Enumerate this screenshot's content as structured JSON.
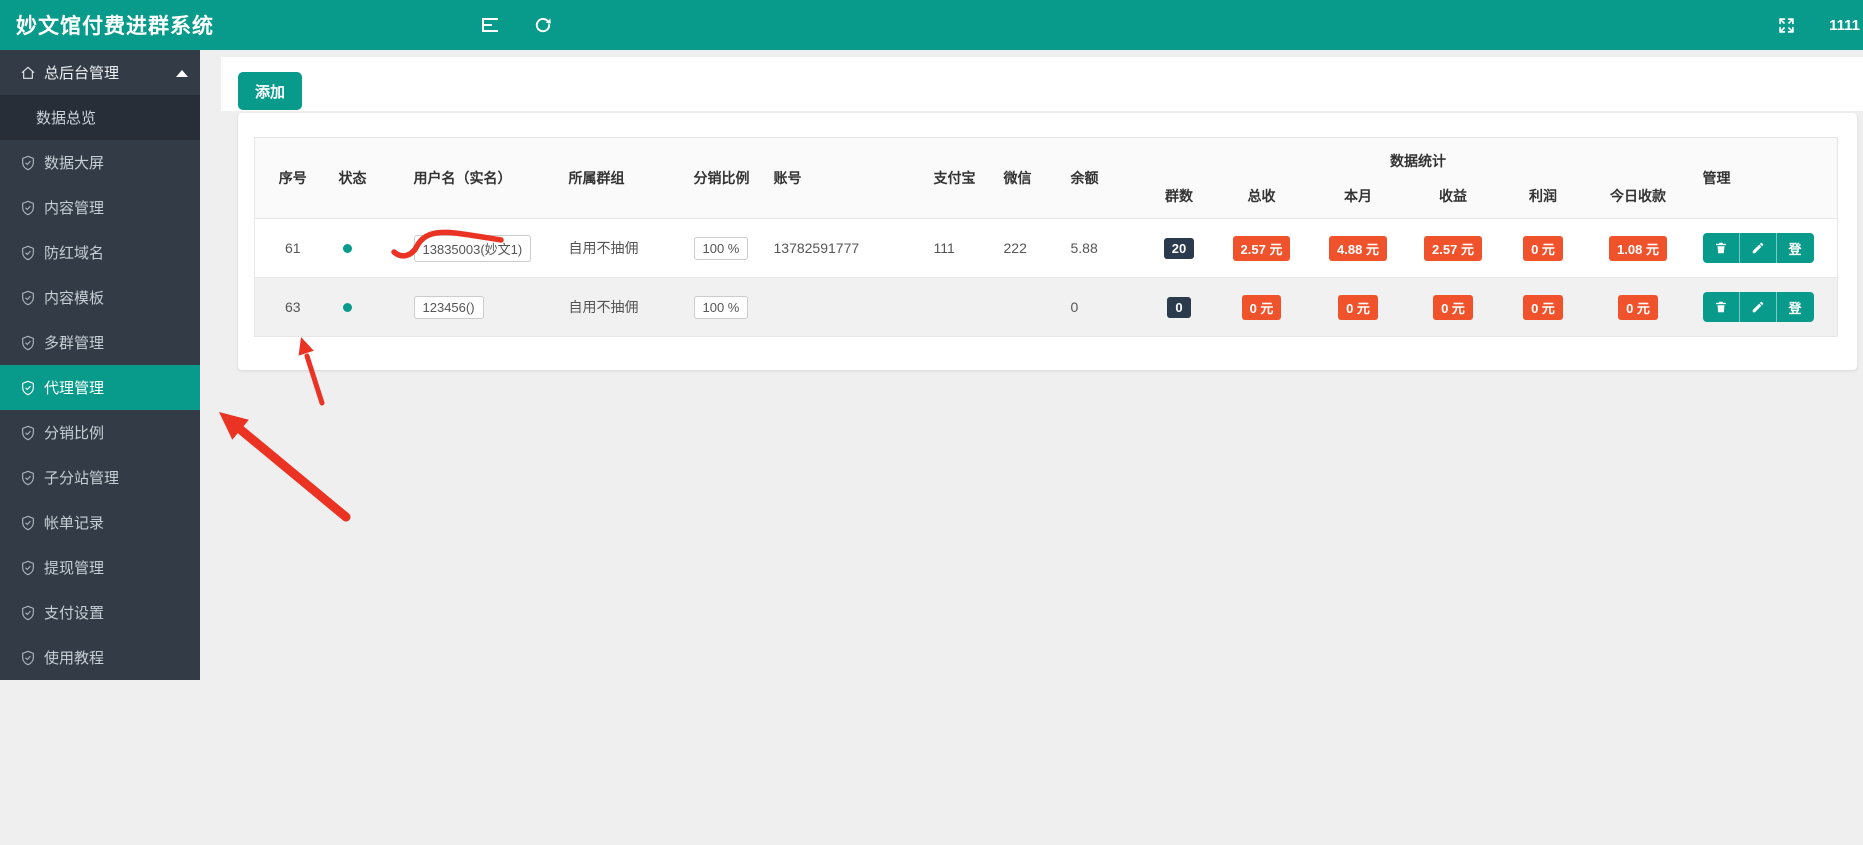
{
  "header": {
    "title": "妙文馆付费进群系统",
    "right_text": "1111",
    "icons": [
      "sidebar-toggle-icon",
      "refresh-icon",
      "fullscreen-icon"
    ]
  },
  "sidebar": {
    "items": [
      {
        "label": "总后台管理",
        "type": "parent",
        "active": false
      },
      {
        "label": "数据总览",
        "type": "sub",
        "active": true
      },
      {
        "label": "数据大屏",
        "type": "item",
        "active": false
      },
      {
        "label": "内容管理",
        "type": "item",
        "active": false
      },
      {
        "label": "防红域名",
        "type": "item",
        "active": false
      },
      {
        "label": "内容模板",
        "type": "item",
        "active": false
      },
      {
        "label": "多群管理",
        "type": "item",
        "active": false
      },
      {
        "label": "代理管理",
        "type": "item",
        "active": true
      },
      {
        "label": "分销比例",
        "type": "item",
        "active": false
      },
      {
        "label": "子分站管理",
        "type": "item",
        "active": false
      },
      {
        "label": "帐单记录",
        "type": "item",
        "active": false
      },
      {
        "label": "提现管理",
        "type": "item",
        "active": false
      },
      {
        "label": "支付设置",
        "type": "item",
        "active": false
      },
      {
        "label": "使用教程",
        "type": "item",
        "active": false
      }
    ]
  },
  "toolbar": {
    "add_label": "添加"
  },
  "table": {
    "columns": [
      "序号",
      "状态",
      "用户名（实名）",
      "所属群组",
      "分销比例",
      "账号",
      "支付宝",
      "微信",
      "余额"
    ],
    "stats_header": "数据统计",
    "stat_columns": [
      "群数",
      "总收",
      "本月",
      "收益",
      "利润",
      "今日收款"
    ],
    "manage_header": "管理",
    "action_login_label": "登",
    "action_icons": [
      "trash-icon",
      "pencil-icon"
    ],
    "rows": [
      {
        "id": "61",
        "status": "online",
        "username": "13835003(妙文1)",
        "username_scribbled": true,
        "group": "自用不抽佣",
        "ratio": "100 %",
        "account": "13782591777",
        "alipay": "111",
        "wechat": "222",
        "balance": "5.88",
        "stats": {
          "groups": "20",
          "total": "2.57 元",
          "month": "4.88 元",
          "earnings": "2.57 元",
          "profit": "0 元",
          "today": "1.08 元"
        }
      },
      {
        "id": "63",
        "status": "online",
        "username": "123456()",
        "username_scribbled": false,
        "group": "自用不抽佣",
        "ratio": "100 %",
        "account": "",
        "alipay": "",
        "wechat": "",
        "balance": "0",
        "stats": {
          "groups": "0",
          "total": "0 元",
          "month": "0 元",
          "earnings": "0 元",
          "profit": "0 元",
          "today": "0 元"
        }
      }
    ]
  },
  "colors": {
    "teal_accent": "#089b8c",
    "sidebar_bg": "#333b46",
    "sidebar_subitem_bg": "#272e38",
    "orange_badge": "#f0532c",
    "navy_badge": "#2b3a4c",
    "annotation_red": "#ea3323",
    "page_bg": "#efeff0",
    "stripe_row_bg": "#f1f1f1"
  }
}
